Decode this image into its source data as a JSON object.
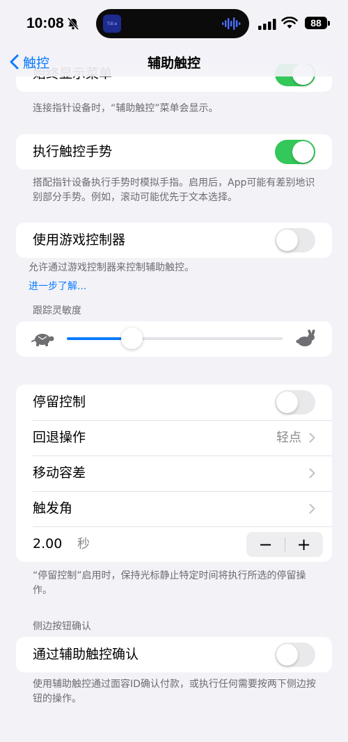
{
  "status": {
    "time": "10:08",
    "battery": "88",
    "island_label": "Tdl.e"
  },
  "nav": {
    "back_label": "触控",
    "title": "辅助触控"
  },
  "sections": {
    "always_menu": {
      "label": "始终显示菜单",
      "on": true,
      "note": "连接指针设备时，“辅助触控”菜单会显示。"
    },
    "perform_gestures": {
      "label": "执行触控手势",
      "on": true,
      "note": "搭配指针设备执行手势时模拟手指。启用后，App可能有差别地识别部分手势。例如，滚动可能优先于文本选择。"
    },
    "game_controller": {
      "label": "使用游戏控制器",
      "on": false,
      "note": "允许通过游戏控制器来控制辅助触控。",
      "learn_more": "进一步了解..."
    },
    "tracking": {
      "header": "跟踪灵敏度",
      "level": 0.3
    },
    "dwell": {
      "dwell_label": "停留控制",
      "dwell_on": false,
      "fallback_label": "回退操作",
      "fallback_value": "轻点",
      "movement_label": "移动容差",
      "hot_corners_label": "触发角",
      "time_value": "2.00",
      "time_unit": "秒",
      "minus": "−",
      "plus": "+",
      "note": "“停留控制”启用时，保持光标静止特定时间将执行所选的停留操作。"
    },
    "side_button": {
      "header": "侧边按钮确认",
      "label": "通过辅助触控确认",
      "on": false,
      "note": "使用辅助触控通过面容ID确认付款，或执行任何需要按两下侧边按钮的操作。"
    }
  },
  "colors": {
    "accent": "#0a7aff",
    "toggle_on": "#34c759",
    "toggle_off": "#e9e9eb",
    "background": "#f2f2f7"
  }
}
